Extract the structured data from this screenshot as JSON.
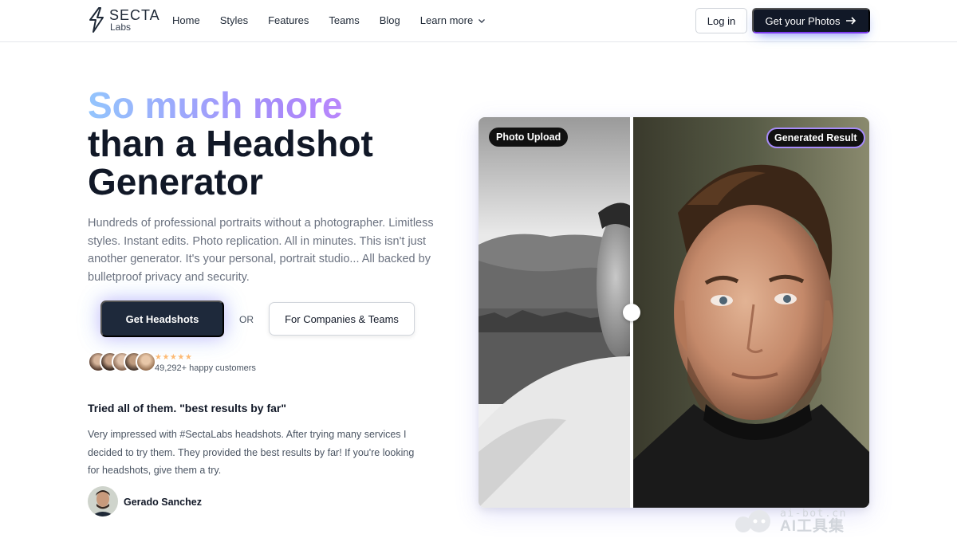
{
  "header": {
    "logo_name": "SECTA",
    "logo_sub": "Labs",
    "nav": [
      {
        "label": "Home"
      },
      {
        "label": "Styles"
      },
      {
        "label": "Features"
      },
      {
        "label": "Teams"
      },
      {
        "label": "Blog"
      },
      {
        "label": "Learn more"
      }
    ],
    "login_label": "Log in",
    "cta_label": "Get your Photos"
  },
  "hero": {
    "title_gradient": "So much more",
    "title_line2": "than a Headshot",
    "title_line3": "Generator",
    "description": "Hundreds of professional portraits without a photographer. Limitless styles. Instant edits. Photo replication. All in minutes. This isn't just another generator. It's your personal, portrait studio... All backed by bulletproof privacy and security.",
    "primary_button": "Get Headshots",
    "or_text": "OR",
    "secondary_button": "For Companies & Teams",
    "stars": "★★★★★",
    "customers": "49,292+ happy customers"
  },
  "testimonial": {
    "title": "Tried all of them. \"best results by far\"",
    "text": "Very impressed with #SectaLabs headshots. After trying many services I decided to try them. They provided the best results by far! If you're looking for headshots, give them a try.",
    "author": "Gerado Sanchez"
  },
  "comparison": {
    "left_label": "Photo Upload",
    "right_label": "Generated Result"
  },
  "watermark": {
    "url": "ai-bot.cn",
    "cn": "AI工具集"
  },
  "colors": {
    "primary_dark": "#111827",
    "accent_purple": "#a78bfa",
    "muted_text": "#6b7280"
  }
}
